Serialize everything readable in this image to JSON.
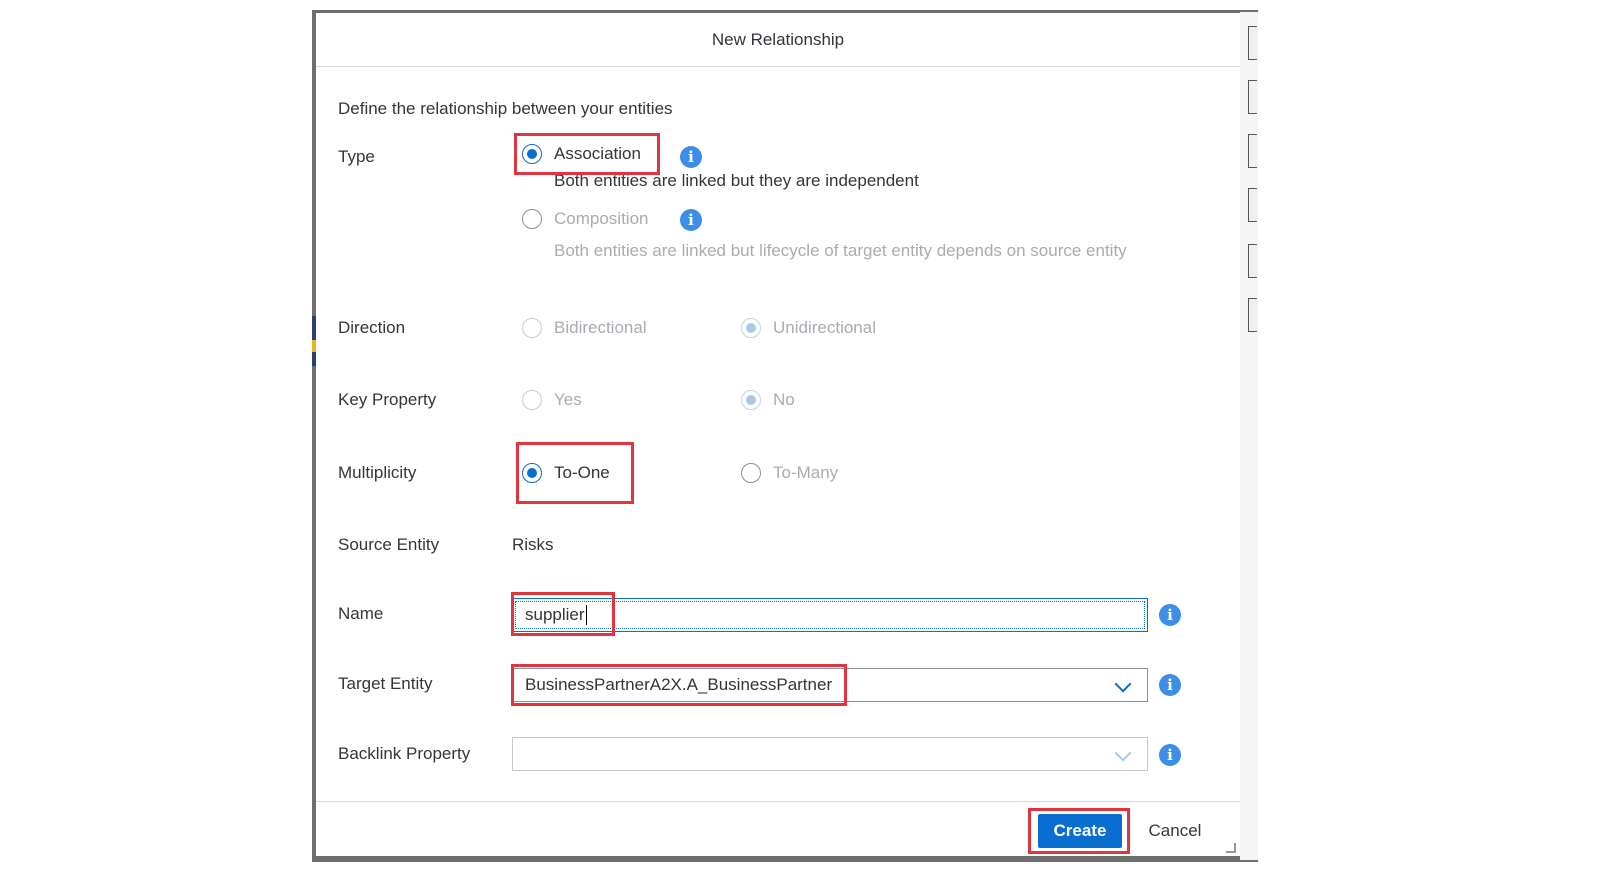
{
  "dialog": {
    "title": "New Relationship",
    "intro": "Define the relationship between your entities"
  },
  "type": {
    "label": "Type",
    "association": {
      "label": "Association",
      "description": "Both entities are linked but they are independent",
      "selected": true
    },
    "composition": {
      "label": "Composition",
      "description": "Both entities are linked but lifecycle of target entity depends on source entity",
      "selected": false
    }
  },
  "direction": {
    "label": "Direction",
    "options": [
      "Bidirectional",
      "Unidirectional"
    ],
    "selected": "Unidirectional"
  },
  "key_property": {
    "label": "Key Property",
    "options": [
      "Yes",
      "No"
    ],
    "selected": "No"
  },
  "multiplicity": {
    "label": "Multiplicity",
    "options": [
      "To-One",
      "To-Many"
    ],
    "selected": "To-One"
  },
  "source_entity": {
    "label": "Source Entity",
    "value": "Risks"
  },
  "name": {
    "label": "Name",
    "value": "supplier"
  },
  "target_entity": {
    "label": "Target Entity",
    "value": "BusinessPartnerA2X.A_BusinessPartner"
  },
  "backlink_property": {
    "label": "Backlink Property",
    "value": ""
  },
  "footer": {
    "create_label": "Create",
    "cancel_label": "Cancel"
  },
  "icons": {
    "info": "info-icon",
    "dropdown": "chevron-down-icon"
  },
  "colors": {
    "accent": "#0a6ed1",
    "highlight": "#e0353f",
    "info": "#3c8ee6"
  }
}
